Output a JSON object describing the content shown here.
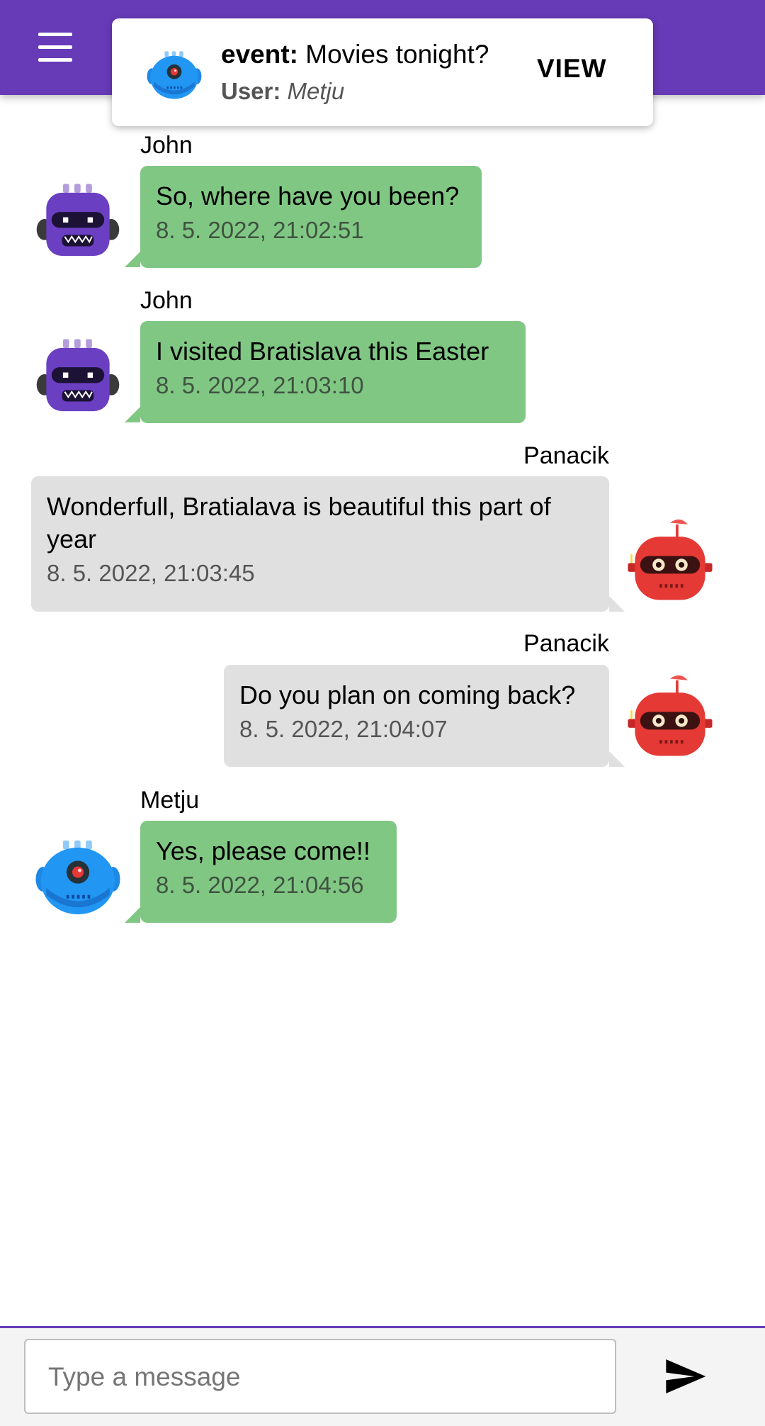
{
  "appbar": {
    "menu_icon": "menu-icon"
  },
  "notification": {
    "avatar_icon": "blue-robot-avatar-icon",
    "event_label": "event:",
    "event_text": "Movies tonight?",
    "user_label": "User:",
    "user_name": "Metju",
    "view_label": "VIEW"
  },
  "messages": [
    {
      "sender": "John",
      "text": "So, where have you been?",
      "time": "8. 5. 2022, 21:02:51",
      "avatar": "purple-robot-avatar-icon",
      "color": "#81c784"
    },
    {
      "sender": "John",
      "text": "I visited Bratislava this Easter",
      "time": "8. 5. 2022, 21:03:10",
      "avatar": "purple-robot-avatar-icon",
      "color": "#81c784"
    },
    {
      "sender": "Panacik",
      "text_line1": "Wonderfull, Bratialava is beautiful this part of",
      "text_line2": "year",
      "time": "8. 5. 2022, 21:03:45",
      "avatar": "red-robot-avatar-icon",
      "color": "#e0e0e0"
    },
    {
      "sender": "Panacik",
      "text": "Do you plan on coming back?",
      "time": "8. 5. 2022, 21:04:07",
      "avatar": "red-robot-avatar-icon",
      "color": "#e0e0e0"
    },
    {
      "sender": "Metju",
      "text": "Yes, please come!!",
      "time": "8. 5. 2022, 21:04:56",
      "avatar": "blue-robot-avatar-icon",
      "color": "#81c784"
    }
  ],
  "composer": {
    "placeholder": "Type a message",
    "send_icon": "send-icon"
  },
  "colors": {
    "accent": "#673ab7",
    "mine_bubble": "#81c784",
    "other_bubble": "#e0e0e0"
  }
}
